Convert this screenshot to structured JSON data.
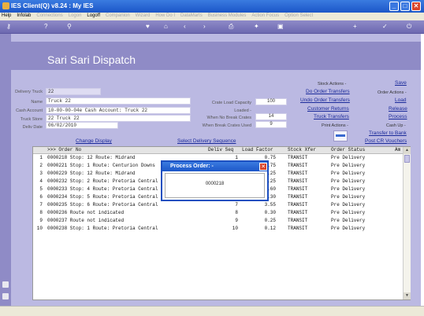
{
  "window": {
    "title": "IES Client(Q) v8.24 : My IES",
    "min": "_",
    "max": "□",
    "close": "✕"
  },
  "menu": [
    {
      "label": "Help",
      "enabled": true
    },
    {
      "label": "Infolab",
      "enabled": true
    },
    {
      "label": "Connections",
      "enabled": false
    },
    {
      "label": "Logon",
      "enabled": false
    },
    {
      "label": "Logoff",
      "enabled": true
    },
    {
      "label": "Companion",
      "enabled": false
    },
    {
      "label": "Wizard",
      "enabled": false
    },
    {
      "label": "How Do I",
      "enabled": false
    },
    {
      "label": "DataMarts",
      "enabled": false
    },
    {
      "label": "Business Modules",
      "enabled": false
    },
    {
      "label": "Action Focus",
      "enabled": false
    },
    {
      "label": "Option Select",
      "enabled": false
    }
  ],
  "page": {
    "title": "Sari Sari Dispatch"
  },
  "fields": {
    "delivery_truck_label": "Delivery Truck",
    "delivery_truck": "22",
    "name_label": "Name",
    "name": "Truck 22",
    "cash_account_label": "Cash Account",
    "cash_account": "10-00-00-04e Cash Account: Truck 22",
    "truck_store_label": "Truck Store",
    "truck_store": "22 Truck 22",
    "deliv_date_label": "Deliv Date",
    "deliv_date": "06/02/2010",
    "crate_load_label": "Crate Load Capacity",
    "crate_load": "100",
    "loaded_label": "Loaded -",
    "no_break_label": "When No Break Crates",
    "no_break": "14",
    "break_label": "When Break Crates Used",
    "break": "9"
  },
  "links": {
    "change_display": "Change Display",
    "select_delivery": "Select Delivery Sequence",
    "stock_actions": "Stock Actions -",
    "save": "Save",
    "do_order_transfers": "Do Order Transfers",
    "order_actions": "Order Actions -",
    "undo_order_transfers": "Undo Order Transfers",
    "load": "Load",
    "customer_returns": "Customer Returns",
    "release": "Release",
    "truck_transfers": "Truck Transfers",
    "process": "Process",
    "print_actions": "Print Actions -",
    "cash_up": "Cash Up -",
    "transfer_to_bank": "Transfer to Bank",
    "post_cr_vouchers": "Post CR Vouchers"
  },
  "table": {
    "headers": [
      ">>> Order No",
      "Deliv Seq",
      "Load Factor",
      "Stock Xfer",
      "Order Status",
      "Am"
    ],
    "rows": [
      {
        "n": "1",
        "order": "0000218 Stop: 12 Route: Midrand",
        "seq": "1",
        "load": "0.75",
        "xfer": "TRANSIT",
        "status": "Pre Delivery"
      },
      {
        "n": "2",
        "order": "0000221 Stop: 1 Route: Centurion Downs",
        "seq": "2",
        "load": "0.75",
        "xfer": "TRANSIT",
        "status": "Pre Delivery"
      },
      {
        "n": "3",
        "order": "0000229 Stop: 12 Route: Midrand",
        "seq": "3",
        "load": "1.25",
        "xfer": "TRANSIT",
        "status": "Pre Delivery"
      },
      {
        "n": "4",
        "order": "0000232 Stop: 2 Route: Pretoria Central",
        "seq": "4",
        "load": "2.25",
        "xfer": "TRANSIT",
        "status": "Pre Delivery"
      },
      {
        "n": "5",
        "order": "0000233 Stop: 4 Route: Pretoria Central",
        "seq": "5",
        "load": "0.60",
        "xfer": "TRANSIT",
        "status": "Pre Delivery"
      },
      {
        "n": "6",
        "order": "0000234 Stop: 5 Route: Pretoria Central",
        "seq": "6",
        "load": "0.30",
        "xfer": "TRANSIT",
        "status": "Pre Delivery"
      },
      {
        "n": "7",
        "order": "0000235 Stop: 6 Route: Pretoria Central",
        "seq": "7",
        "load": "3.55",
        "xfer": "TRANSIT",
        "status": "Pre Delivery"
      },
      {
        "n": "8",
        "order": "0000236 Route not indicated",
        "seq": "8",
        "load": "0.30",
        "xfer": "TRANSIT",
        "status": "Pre Delivery"
      },
      {
        "n": "9",
        "order": "0000237 Route not indicated",
        "seq": "9",
        "load": "0.25",
        "xfer": "TRANSIT",
        "status": "Pre Delivery"
      },
      {
        "n": "10",
        "order": "0000238 Stop: 1 Route: Pretoria Central",
        "seq": "10",
        "load": "0.12",
        "xfer": "TRANSIT",
        "status": "Pre Delivery"
      }
    ]
  },
  "dialog": {
    "title": "Process Order: -",
    "body": "0000218",
    "close": "✕"
  },
  "colors": {
    "accent": "#8f8bc6",
    "panel": "#bbb9e2",
    "titlebar": "#1c56c8",
    "link": "#1a2a9a"
  }
}
